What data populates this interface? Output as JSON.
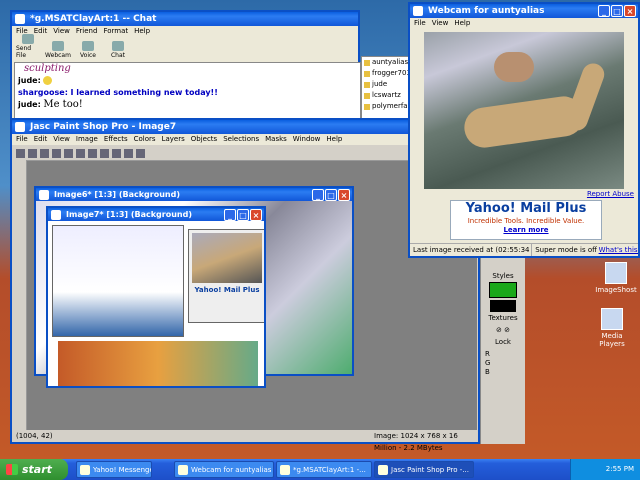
{
  "chat": {
    "title": "*g.MSATClayArt:1 -- Chat",
    "menu": [
      "File",
      "Edit",
      "View",
      "Friend",
      "Format",
      "Help"
    ],
    "toolbar": [
      "Send File",
      "Webcam",
      "Voice",
      "Chat"
    ],
    "messages": [
      {
        "who": "",
        "text": "sculpting"
      },
      {
        "who": "jude:",
        "text": ""
      },
      {
        "who": "shargoose:",
        "text": "I learned something new today!!"
      },
      {
        "who": "jude:",
        "text": "Me too!"
      }
    ],
    "users": [
      "auntyalias",
      "frogger703",
      "jude",
      "lcswartz",
      "polymerfair"
    ]
  },
  "psp": {
    "title": "Jasc Paint Shop Pro - Image7",
    "menu": [
      "File",
      "Edit",
      "View",
      "Image",
      "Effects",
      "Colors",
      "Layers",
      "Objects",
      "Selections",
      "Masks",
      "Window",
      "Help"
    ],
    "image6_title": "Image6* [1:3] (Background)",
    "image7_title": "Image7* [1:3] (Background)",
    "status_coords": "(1004, 42)",
    "status_info": "Image: 1024 x 768 x 16 Million - 2.2 MBytes",
    "nested_ad": "Yahoo! Mail Plus"
  },
  "webcam": {
    "title": "Webcam for auntyalias",
    "menu": [
      "File",
      "View",
      "Help"
    ],
    "report": "Report Abuse",
    "ad_title": "Yahoo! Mail Plus",
    "ad_sub": "Incredible Tools. Incredible Value.",
    "ad_link": "Learn more",
    "status_left": "Last image received at (02:55:34 PM)",
    "status_right": "Super mode is off -",
    "status_link": "What's this?"
  },
  "palette": {
    "styles": "Styles",
    "textures": "Textures",
    "lock": "Lock",
    "rgb": [
      "R",
      "G",
      "B"
    ]
  },
  "desktop": {
    "icons": [
      "ImageShost",
      "Media Players"
    ]
  },
  "taskbar": {
    "start": "start",
    "tasks": [
      "Yahoo! Messenger",
      "Webcam for auntyalias",
      "*g.MSATClayArt:1 -...",
      "Jasc Paint Shop Pro -..."
    ],
    "clock": "2:55 PM"
  },
  "colors": {
    "accent": "#0a4fc5",
    "start_green": "#2f8f2f"
  }
}
